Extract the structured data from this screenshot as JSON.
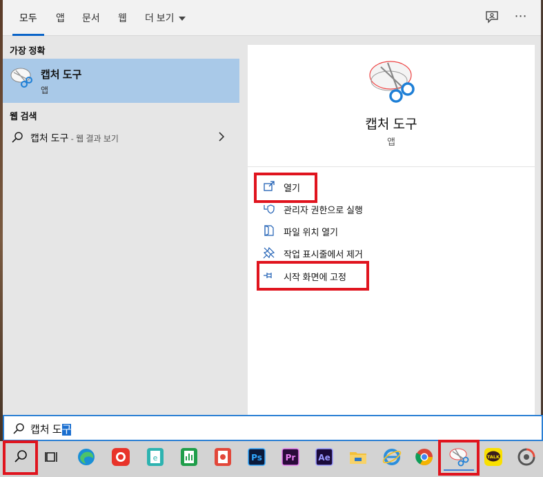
{
  "tabs": [
    {
      "label": "모두"
    },
    {
      "label": "앱"
    },
    {
      "label": "문서"
    },
    {
      "label": "웹"
    },
    {
      "label": "더 보기"
    }
  ],
  "header_icons": {
    "feedback": "feedback-icon",
    "more": "⋯"
  },
  "best_match": {
    "heading": "가장 정확",
    "name": "캡처 도구",
    "type": "앱",
    "icon": "snipping-tool-icon"
  },
  "web_search": {
    "heading": "웹 검색",
    "query": "캡처 도구",
    "suffix": " - 웹 결과 보기"
  },
  "detail": {
    "title": "캡처 도구",
    "subtitle": "앱",
    "actions": [
      {
        "label": "열기",
        "icon": "open-icon"
      },
      {
        "label": "관리자 권한으로 실행",
        "icon": "shield-icon"
      },
      {
        "label": "파일 위치 열기",
        "icon": "folder-icon"
      },
      {
        "label": "작업 표시줄에서 제거",
        "icon": "unpin-icon"
      },
      {
        "label": "시작 화면에 고정",
        "icon": "pin-icon"
      }
    ]
  },
  "search": {
    "typed": "캡처 도",
    "selected": "구"
  },
  "taskbar": {
    "items": [
      {
        "name": "search",
        "color": "#d3d3d3"
      },
      {
        "name": "task-view",
        "color": "#d3d3d3"
      },
      {
        "name": "edge",
        "color": "#1a8fd6"
      },
      {
        "name": "photo-app",
        "color": "#e8332a"
      },
      {
        "name": "word-app",
        "color": "#2db3b0"
      },
      {
        "name": "sheet-app",
        "color": "#1f9e4a"
      },
      {
        "name": "slides-app",
        "color": "#e2473a"
      },
      {
        "name": "photoshop",
        "color": "#0c1a3a",
        "text": "Ps"
      },
      {
        "name": "premiere",
        "color": "#2a0a3a",
        "text": "Pr"
      },
      {
        "name": "after-effects",
        "color": "#1a0a3a",
        "text": "Ae"
      },
      {
        "name": "file-explorer",
        "color": "#f3c13a"
      },
      {
        "name": "internet-explorer",
        "color": "#2b8fdc"
      },
      {
        "name": "chrome",
        "color": "#db4437"
      },
      {
        "name": "snipping-tool",
        "color": "#ffffff"
      },
      {
        "name": "kakaotalk",
        "color": "#f9e000",
        "text": "TALK"
      },
      {
        "name": "other-app",
        "color": "#e74c3c"
      }
    ]
  },
  "colors": {
    "accent": "#0a64c8",
    "highlight": "#e0141e",
    "selection": "#a9c9e8"
  }
}
